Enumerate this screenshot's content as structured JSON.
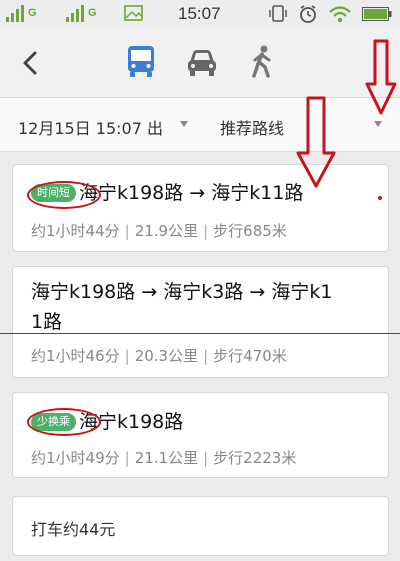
{
  "status_bar": {
    "sim1_label": "G",
    "sim2_label": "G",
    "time": "15:07"
  },
  "transport_modes": [
    "bus",
    "car",
    "walk"
  ],
  "filter": {
    "departure": "12月15日 15:07 出",
    "preference": "推荐路线"
  },
  "routes": [
    {
      "badge": "时间短",
      "title": "海宁k198路 → 海宁k11路",
      "duration": "约1小时44分",
      "distance": "21.9公里",
      "walk": "步行685米"
    },
    {
      "badge": "",
      "title_line1": "海宁k198路 → 海宁k3路 → 海宁k1",
      "title_line2": "1路",
      "duration": "约1小时46分",
      "distance": "20.3公里",
      "walk": "步行470米"
    },
    {
      "badge": "少换乘",
      "title": "海宁k198路",
      "duration": "约1小时49分",
      "distance": "21.1公里",
      "walk": "步行2223米"
    }
  ],
  "taxi": {
    "label": "打车约44元"
  },
  "colors": {
    "bus_blue": "#3b7fd4",
    "badge_green": "#4caf6a",
    "annotation_red": "#c8131a"
  }
}
